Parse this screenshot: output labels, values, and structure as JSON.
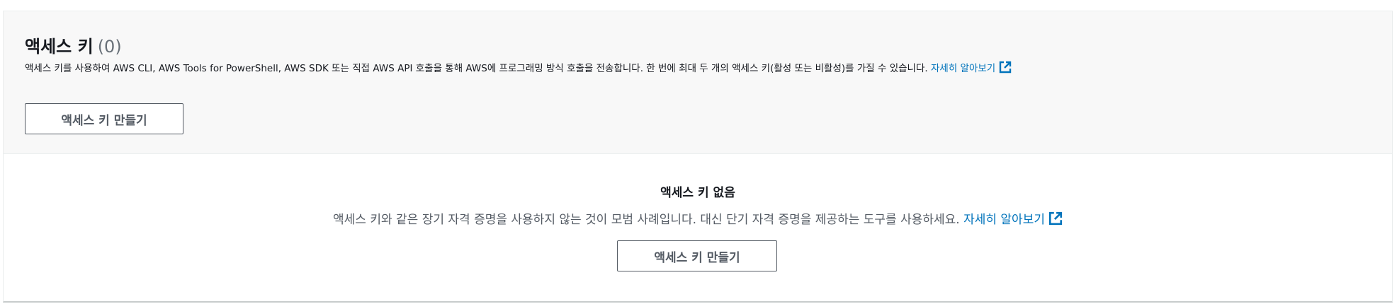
{
  "header": {
    "title": "액세스 키",
    "count": "(0)",
    "description": "액세스 키를 사용하여 AWS CLI, AWS Tools for PowerShell, AWS SDK 또는 직접 AWS API 호출을 통해 AWS에 프로그래밍 방식 호출을 전송합니다. 한 번에 최대 두 개의 액세스 키(활성 또는 비활성)를 가질 수 있습니다.",
    "learn_more": "자세히 알아보기",
    "create_button": "액세스 키 만들기"
  },
  "empty_state": {
    "title": "액세스 키 없음",
    "description": "액세스 키와 같은 장기 자격 증명을 사용하지 않는 것이 모범 사례입니다. 대신 단기 자격 증명을 제공하는 도구를 사용하세요.",
    "learn_more": "자세히 알아보기",
    "create_button": "액세스 키 만들기"
  },
  "icons": {
    "external_link": "external-link-icon"
  },
  "colors": {
    "link": "#0073bb",
    "header_background": "#f8f8f8",
    "button_border": "#545b64",
    "text": "#16191f",
    "muted_text": "#687078"
  }
}
